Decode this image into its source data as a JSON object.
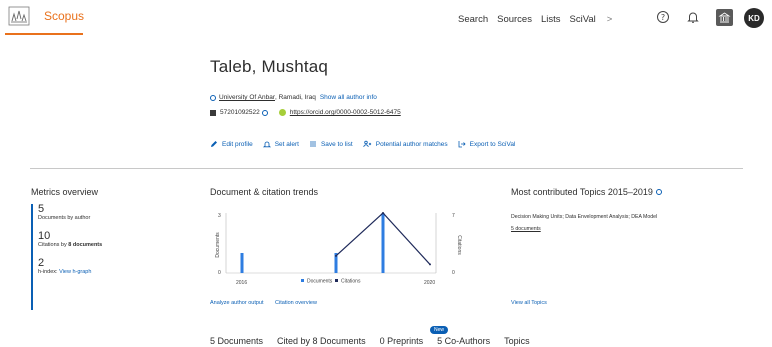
{
  "header": {
    "brand": "Scopus",
    "nav": [
      "Search",
      "Sources",
      "Lists",
      "SciVal"
    ],
    "scival_arrow": ">",
    "avatar_initials": "KD",
    "icons": [
      "help-icon",
      "bell-icon",
      "institution-icon"
    ]
  },
  "author": {
    "name": "Taleb, Mushtaq",
    "affiliation": "University Of Anbar",
    "location": ", Ramadi, Iraq",
    "show_all_info": "Show all author info",
    "author_id": "57201092522",
    "orcid": "https://orcid.org/0000-0002-5012-6475"
  },
  "actions": [
    "Edit profile",
    "Set alert",
    "Save to list",
    "Potential author matches",
    "Export to SciVal"
  ],
  "metrics": {
    "title": "Metrics overview",
    "documents_value": "5",
    "documents_label": "Documents by author",
    "citations_value": "10",
    "citations_label_prefix": "Citations by ",
    "citations_label_bold": "8 documents",
    "hindex_value": "2",
    "hindex_label": "h-index:",
    "hindex_link": "View h-graph"
  },
  "trends": {
    "title": "Document & citation trends",
    "links": [
      "Analyze author output",
      "Citation overview"
    ]
  },
  "chart_data": {
    "type": "bar",
    "x": [
      2016,
      2017,
      2018,
      2019,
      2020
    ],
    "xtick_labels": [
      "2016",
      "2020"
    ],
    "series": [
      {
        "name": "Documents",
        "type": "bar",
        "axis": "left",
        "values": [
          1,
          0,
          1,
          3,
          0
        ],
        "color": "#2e7de1"
      },
      {
        "name": "Citations",
        "type": "line",
        "axis": "right",
        "values": [
          null,
          null,
          2,
          7,
          1
        ],
        "color": "#1f2a5a"
      }
    ],
    "ylabel": "Documents",
    "y2label": "Citations",
    "ylim": [
      0,
      3
    ],
    "y2lim": [
      0,
      7
    ],
    "yticks": [
      "3",
      "0"
    ],
    "y2ticks": [
      "7",
      "0"
    ],
    "legend": "bottom"
  },
  "topics": {
    "title": "Most contributed Topics 2015–2019",
    "topic": "Decision Making Units; Data Envelopment Analysis; DEA Model",
    "docs": "5 documents",
    "view_all": "View all Topics"
  },
  "tabs": [
    {
      "label": "5 Documents",
      "active": true
    },
    {
      "label": "Cited by 8 Documents",
      "active": false
    },
    {
      "label": "0 Preprints",
      "active": false
    },
    {
      "label": "5 Co-Authors",
      "active": false
    },
    {
      "label": "Topics",
      "active": false
    }
  ],
  "new_badge": "New",
  "colors": {
    "brand": "#e9711c",
    "link": "#0a5fb4"
  }
}
